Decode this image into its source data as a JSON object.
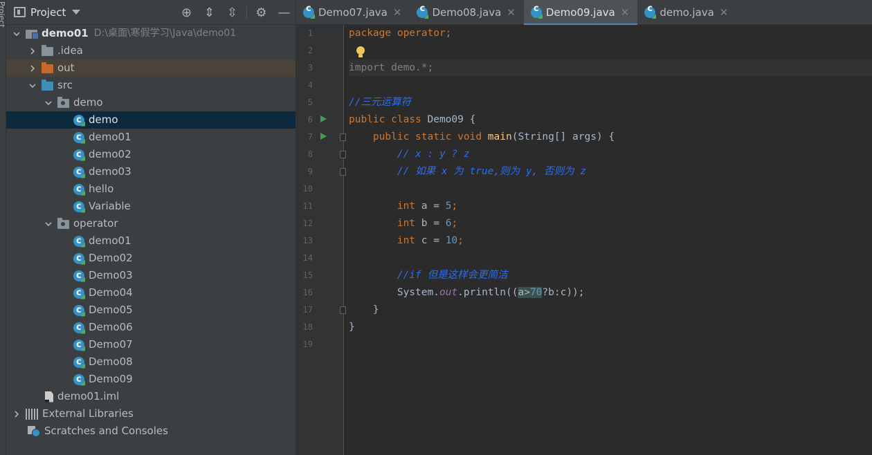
{
  "strip": {
    "label": "Project"
  },
  "project_panel": {
    "title": "Project",
    "tools": {
      "locate": "⊕",
      "expand": "⇕",
      "collapse": "⇳",
      "settings": "⚙",
      "hide": "—"
    }
  },
  "tree": {
    "root": {
      "name": "demo01",
      "path": "D:\\桌面\\寒假学习\\Java\\demo01"
    },
    "idea": ".idea",
    "out": "out",
    "src": "src",
    "pkg_demo": "demo",
    "demo_classes": [
      "demo",
      "demo01",
      "demo02",
      "demo03",
      "hello",
      "Variable"
    ],
    "pkg_operator": "operator",
    "operator_classes": [
      "demo01",
      "Demo02",
      "Demo03",
      "Demo04",
      "Demo05",
      "Demo06",
      "Demo07",
      "Demo08",
      "Demo09"
    ],
    "iml": "demo01.iml",
    "external": "External Libraries",
    "scratches": "Scratches and Consoles"
  },
  "tabs": [
    {
      "label": "Demo07.java",
      "close": "✕"
    },
    {
      "label": "Demo08.java",
      "close": "✕"
    },
    {
      "label": "Demo09.java",
      "close": "✕"
    },
    {
      "label": "demo.java",
      "close": "✕"
    }
  ],
  "editor": {
    "active_tab": "Demo09.java",
    "line_numbers": [
      "1",
      "2",
      "3",
      "4",
      "5",
      "6",
      "7",
      "8",
      "9",
      "10",
      "11",
      "12",
      "13",
      "14",
      "15",
      "16",
      "17",
      "18",
      "19"
    ],
    "code": {
      "l1_kw": "package",
      "l1_rest": " operator;",
      "l3": "import demo.*;",
      "l5": "//三元运算符",
      "l6_kw": "public class",
      "l6_rest": " Demo09 {",
      "l7_kw": "    public static void",
      "l7_m": " main",
      "l7_rest": "(String[] args) {",
      "l8": "        // x : y ? z",
      "l9": "        // 如果 x 为 true,则为 y, 否则为 z",
      "l11_kw": "        int",
      "l11_a": " a = ",
      "l11_n": "5",
      "l11_s": ";",
      "l12_kw": "        int",
      "l12_a": " b = ",
      "l12_n": "6",
      "l12_s": ";",
      "l13_kw": "        int",
      "l13_a": " c = ",
      "l13_n": "10",
      "l13_s": ";",
      "l15": "        //if 但是这样会更简洁",
      "l16_a": "        System.",
      "l16_f": "out",
      "l16_b": ".println((",
      "l16_h": "a>",
      "l16_n": "70",
      "l16_c": "?b:c));",
      "l17": "    }",
      "l18": "}"
    }
  },
  "colors": {
    "keyword": "#cc7832",
    "number": "#6897bb",
    "comment": "#2c6df2",
    "method": "#ffc66d",
    "accent": "#4a88c7"
  }
}
